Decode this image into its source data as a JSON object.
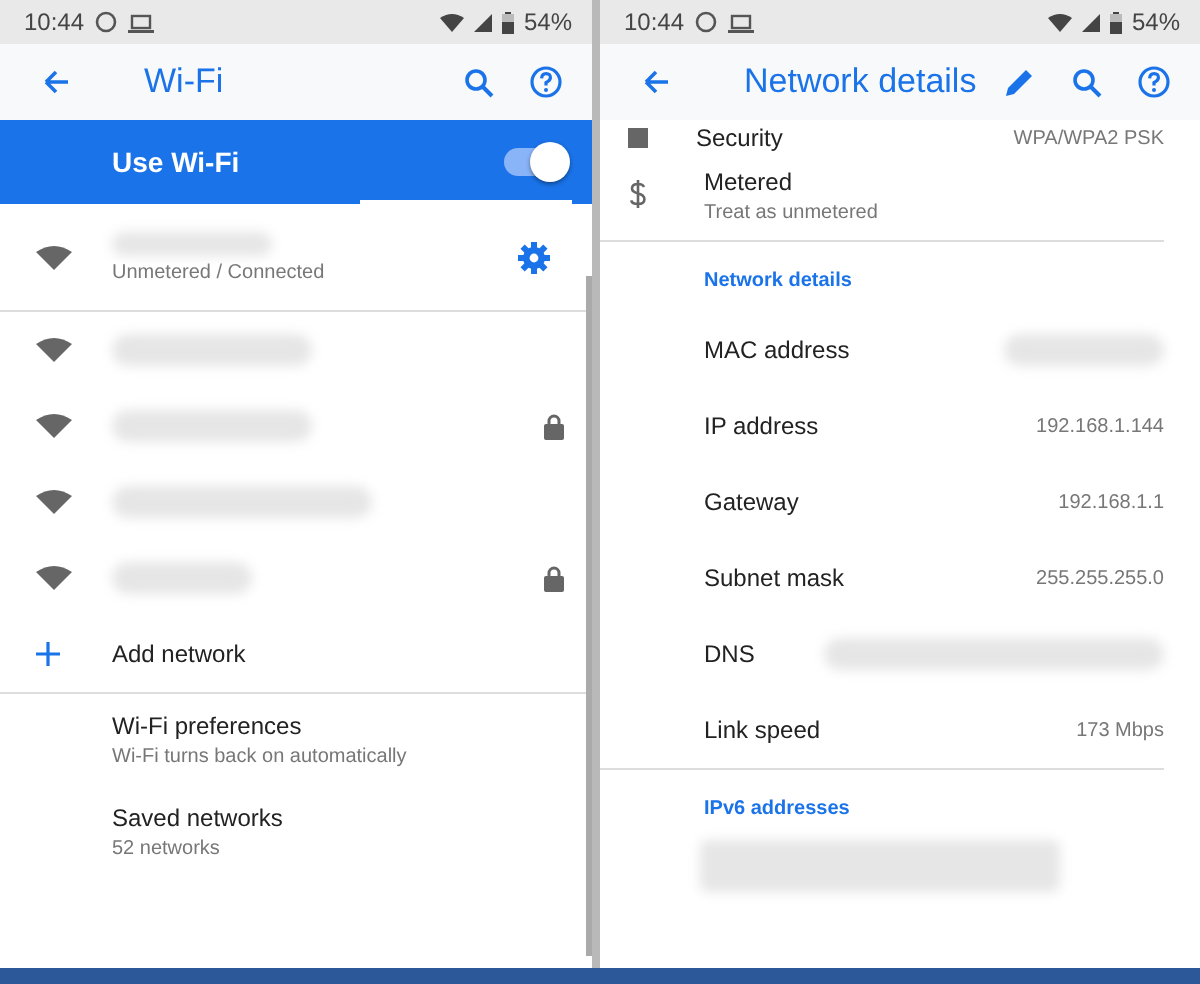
{
  "wifi_screen": {
    "status_bar": {
      "time": "10:44",
      "battery": "54%"
    },
    "app_bar": {
      "title": "Wi-Fi"
    },
    "master_switch": {
      "label": "Use Wi-Fi",
      "on": true
    },
    "connected_network": {
      "status": "Unmetered / Connected"
    },
    "networks": [
      {
        "locked": false
      },
      {
        "locked": true
      },
      {
        "locked": false
      },
      {
        "locked": true
      }
    ],
    "add_network": "Add network",
    "settings": [
      {
        "title": "Wi-Fi preferences",
        "subtitle": "Wi-Fi turns back on automatically"
      },
      {
        "title": "Saved networks",
        "subtitle": "52 networks"
      }
    ]
  },
  "details_screen": {
    "status_bar": {
      "time": "10:44",
      "battery": "54%"
    },
    "app_bar": {
      "title": "Network details"
    },
    "security": {
      "label": "Security",
      "value": "WPA/WPA2 PSK"
    },
    "metered": {
      "title": "Metered",
      "subtitle": "Treat as unmetered"
    },
    "details_heading": "Network details",
    "rows": [
      {
        "label": "MAC address",
        "redacted": true
      },
      {
        "label": "IP address",
        "value": "192.168.1.144",
        "redacted": false
      },
      {
        "label": "Gateway",
        "value": "192.168.1.1",
        "redacted": false
      },
      {
        "label": "Subnet mask",
        "value": "255.255.255.0",
        "redacted": false
      },
      {
        "label": "DNS",
        "redacted": true
      },
      {
        "label": "Link speed",
        "value": "173 Mbps",
        "redacted": false
      }
    ],
    "ipv6_heading": "IPv6 addresses"
  }
}
